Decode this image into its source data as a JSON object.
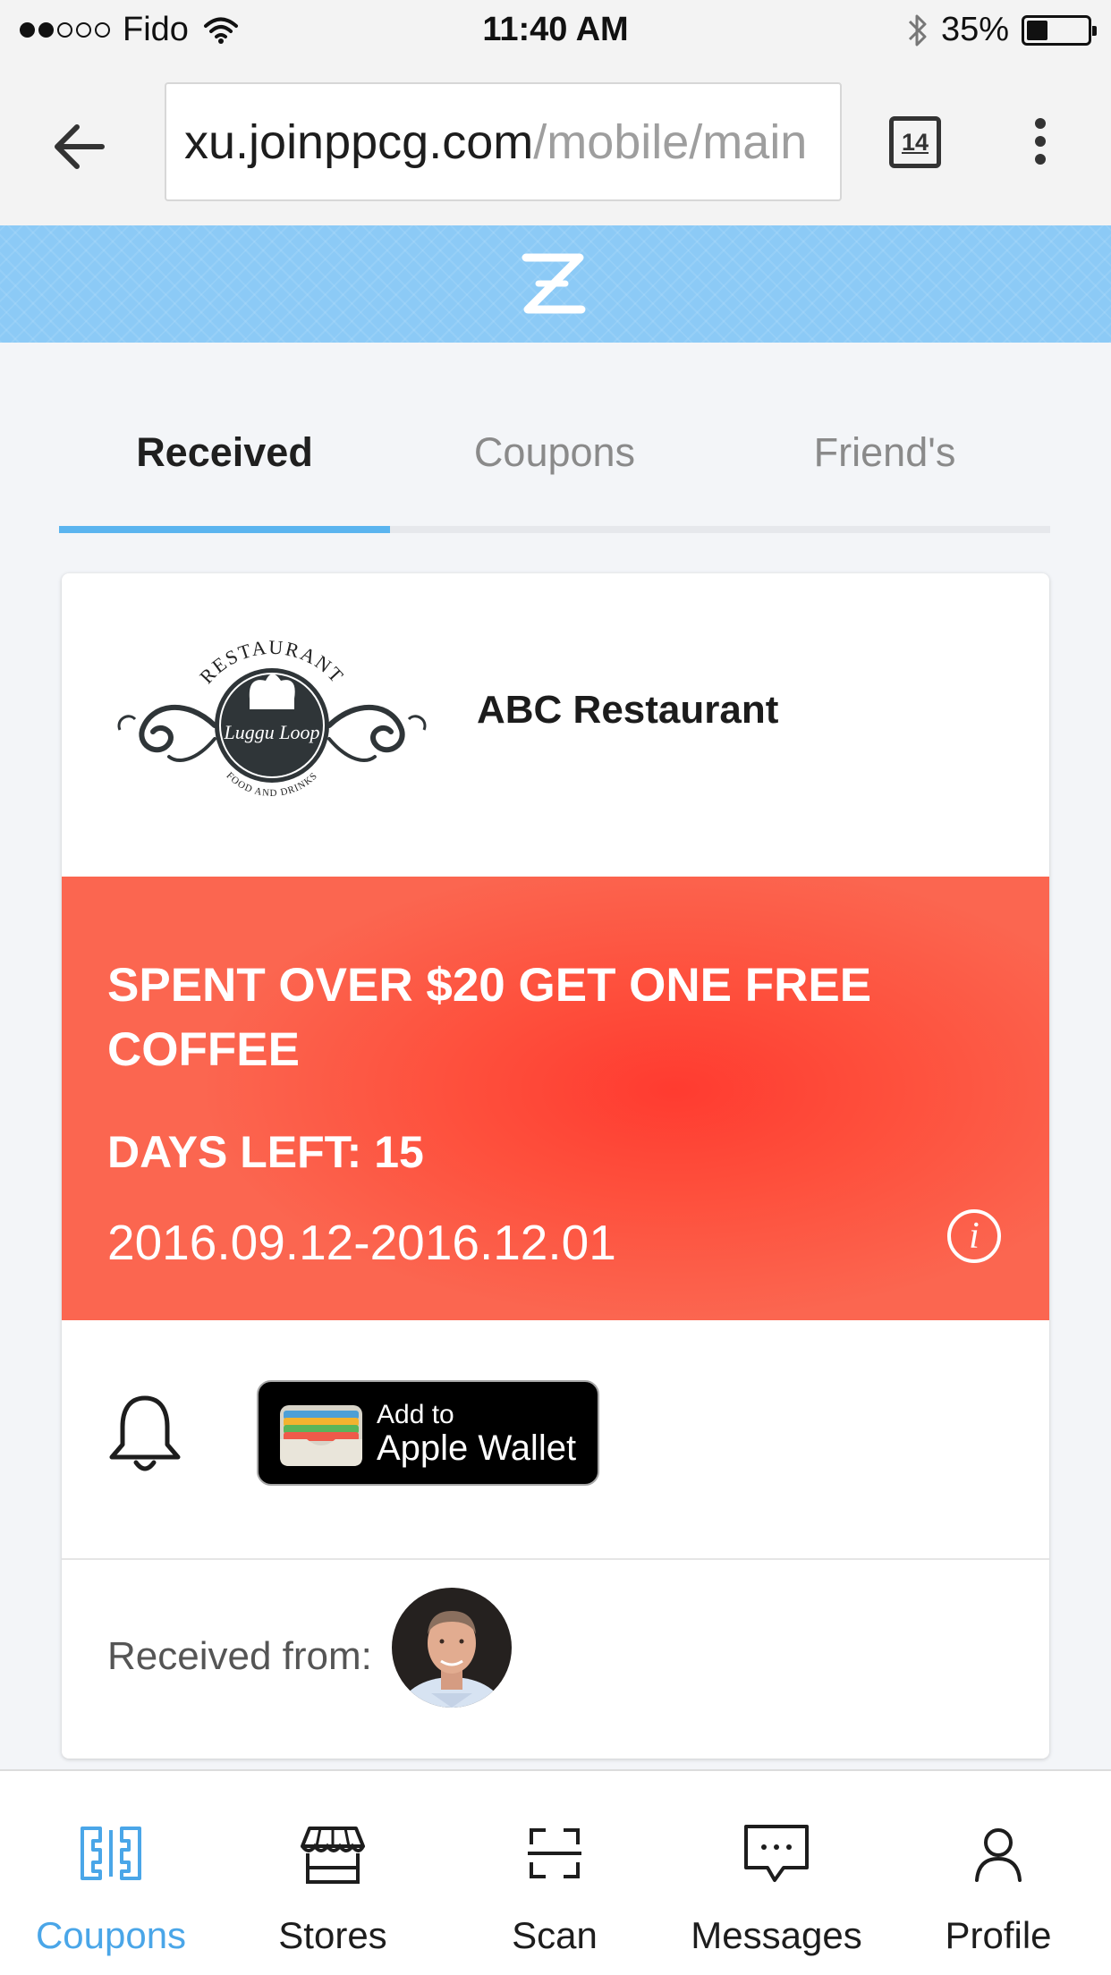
{
  "status_bar": {
    "carrier": "Fido",
    "time": "11:40 AM",
    "battery_text": "35%",
    "battery_level": 0.35,
    "signal_bars_filled": 2,
    "signal_bars_total": 5,
    "icons": [
      "wifi-icon",
      "bluetooth-icon",
      "battery-icon"
    ]
  },
  "browser": {
    "url_host": "xu.joinppcg.com",
    "url_path": "/mobile/main",
    "tab_count": "14",
    "icons": [
      "back-arrow-icon",
      "tabs-icon",
      "overflow-menu-icon"
    ]
  },
  "app": {
    "logo_icon": "z-logo-icon",
    "banner_color": "#8ccaf6"
  },
  "tabs": [
    {
      "label": "Received",
      "active": true
    },
    {
      "label": "Coupons",
      "active": false
    },
    {
      "label": "Friend's",
      "active": false
    }
  ],
  "card": {
    "merchant_name": "ABC Restaurant",
    "logo_text_top": "RESTAURANT",
    "logo_text_bottom": "FOOD AND DRINKS",
    "logo_emblem": "Luggu Loop",
    "offer_title": "SPENT OVER $20 GET ONE FREE COFFEE",
    "days_left": "DAYS LEFT: 15",
    "date_range": "2016.09.12-2016.12.01",
    "info_icon": "i",
    "offer_color": "#ff3b30",
    "wallet_small": "Add to",
    "wallet_big": "Apple Wallet",
    "received_label": "Received from:"
  },
  "bottom_nav": [
    {
      "label": "Coupons",
      "icon": "coupons-icon",
      "active": true
    },
    {
      "label": "Stores",
      "icon": "store-icon",
      "active": false
    },
    {
      "label": "Scan",
      "icon": "scan-icon",
      "active": false
    },
    {
      "label": "Messages",
      "icon": "messages-icon",
      "active": false
    },
    {
      "label": "Profile",
      "icon": "profile-icon",
      "active": false
    }
  ],
  "colors": {
    "accent": "#4aa6e8",
    "tab_indicator": "#5ab4ef"
  }
}
